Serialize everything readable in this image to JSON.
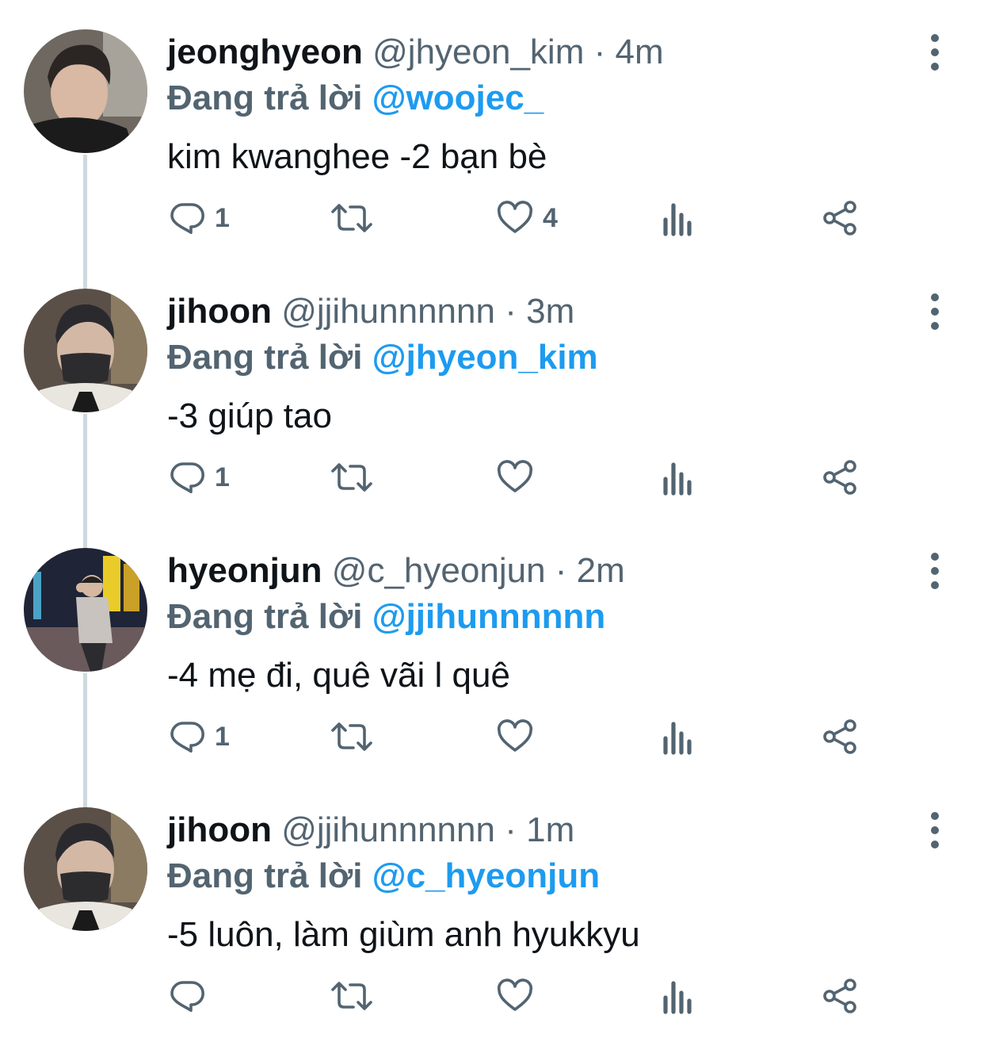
{
  "reply_prefix": "Đang trả lời",
  "colors": {
    "accent": "#1d9bf0",
    "secondary": "#536471",
    "thread_line": "#cfd9de"
  },
  "tweets": [
    {
      "name": "jeonghyeon",
      "handle": "@jhyeon_kim",
      "separator": "·",
      "time": "4m",
      "reply_to": "@woojec_",
      "text": "kim kwanghee -2 bạn bè",
      "replies": "1",
      "retweets": "",
      "likes": "4"
    },
    {
      "name": "jihoon",
      "handle": "@jjihunnnnnn",
      "separator": "·",
      "time": "3m",
      "reply_to": "@jhyeon_kim",
      "text": "-3 giúp tao",
      "replies": "1",
      "retweets": "",
      "likes": ""
    },
    {
      "name": "hyeonjun",
      "handle": "@c_hyeonjun",
      "separator": "·",
      "time": "2m",
      "reply_to": "@jjihunnnnnn",
      "text": "-4 mẹ đi, quê vãi l quê",
      "replies": "1",
      "retweets": "",
      "likes": ""
    },
    {
      "name": "jihoon",
      "handle": "@jjihunnnnnn",
      "separator": "·",
      "time": "1m",
      "reply_to": "@c_hyeonjun",
      "text": "-5 luôn, làm giùm anh hyukkyu",
      "replies": "",
      "retweets": "",
      "likes": ""
    }
  ],
  "icons": {
    "reply": "reply-icon",
    "retweet": "retweet-icon",
    "like": "heart-icon",
    "views": "views-icon",
    "share": "share-icon",
    "more": "more-vertical-icon"
  }
}
